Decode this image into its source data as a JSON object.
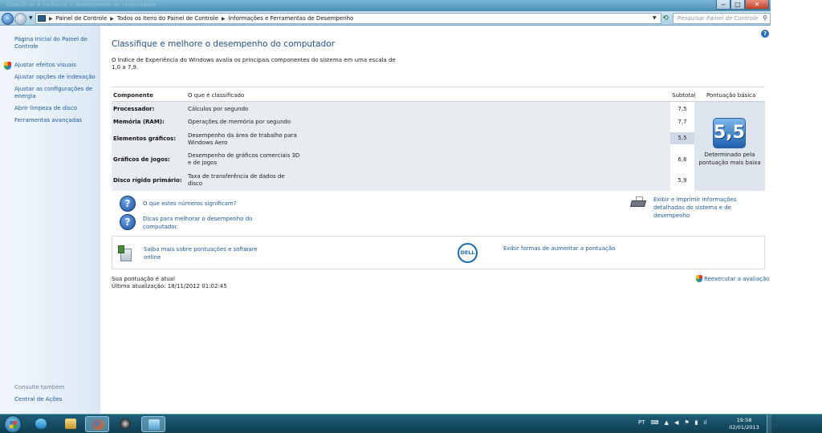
{
  "window": {
    "title_ghost": "Classificar e melhorar o desempenho do computador",
    "caption": {
      "minimize": "‒",
      "maximize": "□",
      "close": "✕"
    }
  },
  "addressbar": {
    "crumbs": [
      "Painel de Controle",
      "Todos os Itens do Painel de Controle",
      "Informações e Ferramentas de Desempenho"
    ],
    "search_placeholder": "Pesquisar Painel de Controle"
  },
  "sidebar": {
    "home": "Página Inicial do Painel de Controle",
    "links": [
      "Ajustar efeitos visuais",
      "Ajustar opções de indexação",
      "Ajustar as configurações de energia",
      "Abrir limpeza de disco",
      "Ferramentas avançadas"
    ],
    "see_also": "Consulte também",
    "action_center": "Central de Ações"
  },
  "main": {
    "title": "Classifique e melhore o desempenho do computador",
    "intro": "O Índice de Experiência do Windows avalia os principais componentes do sistema em uma escala de 1,0 a 7,9."
  },
  "table": {
    "headers": {
      "component": "Componente",
      "rated": "O que é classificado",
      "subtotal": "Subtotal",
      "base_score": "Pontuação básica"
    },
    "rows": [
      {
        "component": "Processador:",
        "description": "Cálculos por segundo",
        "subtotal": "7,5"
      },
      {
        "component": "Memória (RAM):",
        "description": "Operações de memória por segundo",
        "subtotal": "7,7"
      },
      {
        "component": "Elementos gráficos:",
        "description": "Desempenho da área de trabalho para Windows Aero",
        "subtotal": "5,5"
      },
      {
        "component": "Gráficos de jogos:",
        "description": "Desempenho de gráficos comerciais 3D e de jogos",
        "subtotal": "6,6"
      },
      {
        "component": "Disco rígido primário:",
        "description": "Taxa de transferência de dados de disco",
        "subtotal": "5,9"
      }
    ],
    "base_score": "5,5",
    "base_note": "Determinado pela pontuação mais baixa"
  },
  "help": {
    "meaning_link": "O que estes números significam?",
    "tips_link": "Dicas para melhorar o desempenho do computador.",
    "print_link": "Exibir e imprimir informações detalhadas do sistema e de desempenho"
  },
  "promo": {
    "learn_link": "Saiba mais sobre pontuações e software online",
    "dell_logo": "DELL",
    "improve_link": "Exibir formas de aumentar a pontuação"
  },
  "status": {
    "current": "Sua pontuação é atual",
    "last_update": "Última atualização: 18/11/2012 01:02:45",
    "rerun_link": "Reexecutar a avaliação"
  },
  "taskbar": {
    "language": "PT",
    "time": "19:58",
    "date": "02/01/2013"
  }
}
